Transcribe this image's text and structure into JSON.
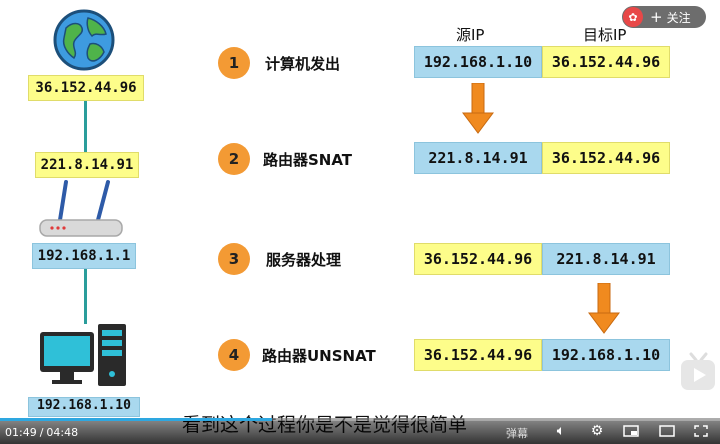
{
  "header": {
    "col_src": "源IP",
    "col_dst": "目标IP"
  },
  "topology": {
    "globe_ip": "36.152.44.96",
    "router_wan_ip": "221.8.14.91",
    "router_lan_ip": "192.168.1.1",
    "pc_ip": "192.168.1.10"
  },
  "steps": [
    {
      "num": "1",
      "label": "计算机发出",
      "src": "192.168.1.10",
      "dst": "36.152.44.96"
    },
    {
      "num": "2",
      "label": "路由器SNAT",
      "src": "221.8.14.91",
      "dst": "36.152.44.96"
    },
    {
      "num": "3",
      "label": "服务器处理",
      "src": "36.152.44.96",
      "dst": "221.8.14.91"
    },
    {
      "num": "4",
      "label": "路由器UNSNAT",
      "src": "36.152.44.96",
      "dst": "192.168.1.10"
    }
  ],
  "subtitle": "看到这个过程你是不是觉得很简单",
  "player": {
    "current_time": "01:49",
    "separator": "/",
    "duration": "04:48",
    "progress": 0.378,
    "follow_label": "关注",
    "follow_plus": "+",
    "danmaku_label": "弹幕"
  },
  "colors": {
    "yellow": "#fdfd8a",
    "blue": "#a9d8ee",
    "orange": "#f39a34",
    "teal": "#2a9d9b"
  }
}
